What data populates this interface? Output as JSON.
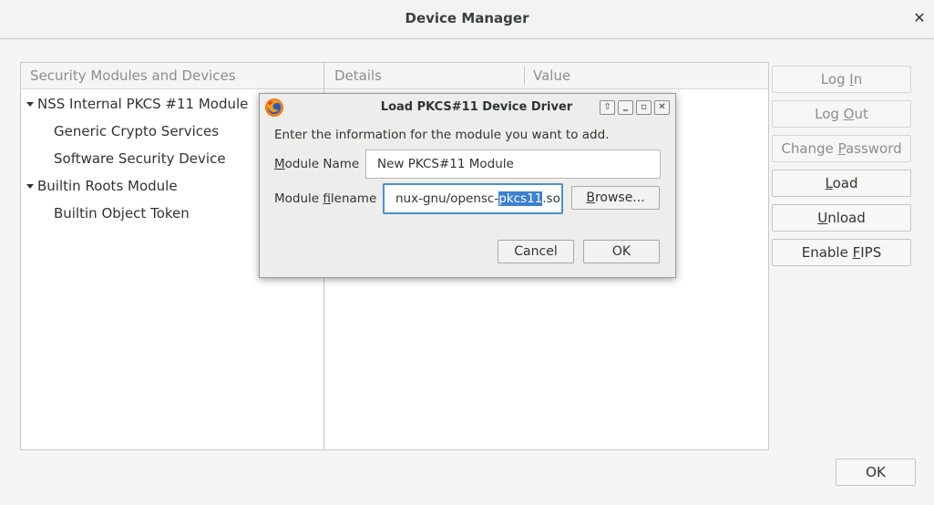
{
  "window": {
    "title": "Device Manager"
  },
  "tree": {
    "header": "Security Modules and Devices",
    "items": [
      {
        "label": "NSS Internal PKCS #11 Module"
      },
      {
        "label": "Generic Crypto Services"
      },
      {
        "label": "Software Security Device"
      },
      {
        "label": "Builtin Roots Module"
      },
      {
        "label": "Builtin Object Token"
      }
    ]
  },
  "details": {
    "col_details": "Details",
    "col_value": "Value"
  },
  "buttons": {
    "login": {
      "pre": "Log ",
      "u": "I",
      "post": "n"
    },
    "logout": {
      "pre": "Log ",
      "u": "O",
      "post": "ut"
    },
    "change_password": {
      "pre": "Change ",
      "u": "P",
      "post": "assword"
    },
    "load": {
      "pre": "",
      "u": "L",
      "post": "oad"
    },
    "unload": {
      "pre": "",
      "u": "U",
      "post": "nload"
    },
    "enable_fips": {
      "pre": "Enable ",
      "u": "F",
      "post": "IPS"
    },
    "ok": "OK"
  },
  "dialog": {
    "title": "Load PKCS#11 Device Driver",
    "intro": "Enter the information for the module you want to add.",
    "module_name_label": {
      "pre": "",
      "u": "M",
      "post": "odule Name"
    },
    "module_name_value": "New PKCS#11 Module",
    "module_filename_label": {
      "pre": "Module ",
      "u": "f",
      "post": "ilename"
    },
    "module_filename_value": {
      "before": "nux-gnu/opensc-",
      "selected": "pkcs11",
      "after": ".so"
    },
    "browse": {
      "pre": "",
      "u": "B",
      "post": "rowse..."
    },
    "cancel": "Cancel",
    "ok": "OK"
  },
  "colors": {
    "accent": "#4a90d9",
    "selection": "#3d80d1"
  },
  "icons": [
    "close-icon",
    "firefox-icon",
    "arrow-up-icon",
    "minimize-icon",
    "maximize-icon",
    "close-icon",
    "expand-triangle-icon"
  ]
}
